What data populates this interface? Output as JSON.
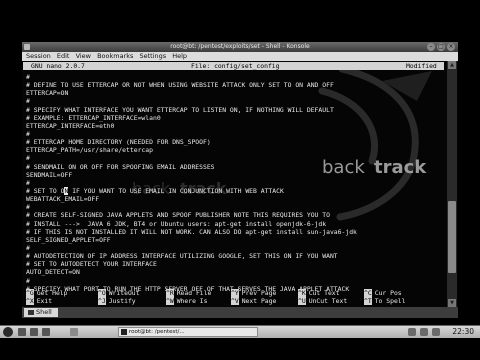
{
  "window": {
    "title": "root@bt: /pentest/exploits/set - Shell - Konsole"
  },
  "menubar": {
    "items": [
      "Session",
      "Edit",
      "View",
      "Bookmarks",
      "Settings",
      "Help"
    ]
  },
  "nano": {
    "version": "GNU nano 2.0.7",
    "file": "File: config/set_config",
    "status": "Modified"
  },
  "editor": {
    "lines": [
      "#",
      "# DEFINE TO USE ETTERCAP OR NOT WHEN USING WEBSITE ATTACK ONLY SET TO ON AND OFF",
      "ETTERCAP=ON",
      "#",
      "# SPECIFY WHAT INTERFACE YOU WANT ETTERCAP TO LISTEN ON, IF NOTHING WILL DEFAULT",
      "# EXAMPLE: ETTERCAP_INTERFACE=wlan0",
      "ETTERCAP_INTERFACE=eth0",
      "#",
      "# ETTERCAP HOME DIRECTORY (NEEDED FOR DNS_SPOOF)",
      "ETTERCAP_PATH=/usr/share/ettercap",
      "#",
      "# SENDMAIL ON OR OFF FOR SPOOFING EMAIL ADDRESSES",
      "SENDMAIL=OFF",
      "#",
      "# SET TO ON IF YOU WANT TO USE EMAIL IN CONJUNCTION WITH WEB ATTACK",
      "WEBATTACK_EMAIL=OFF",
      "#",
      "# CREATE SELF-SIGNED JAVA APPLETS AND SPOOF PUBLISHER NOTE THIS REQUIRES YOU TO",
      "# INSTALL --->  JAVA 6 JDK, BT4 or Ubuntu users: apt-get install openjdk-6-jdk",
      "# IF THIS IS NOT INSTALLED IT WILL NOT WORK. CAN ALSO DO apt-get install sun-java6-jdk",
      "SELF_SIGNED_APPLET=OFF",
      "#",
      "# AUTODETECTION OF IP ADDRESS INTERFACE UTILIZING GOOGLE, SET THIS ON IF YOU WANT",
      "# SET TO AUTODETECT YOUR INTERFACE",
      "AUTO_DETECT=ON",
      "#",
      "# SPECIFY WHAT PORT TO RUN THE HTTP SERVER OFF OF THAT SERVES THE JAVA APPLET ATTACK"
    ],
    "cursor_line": 14,
    "cursor_before": "# SET TO O",
    "cursor_char": "N",
    "cursor_after": " IF YOU WANT TO USE EMAIL IN CONJUNCTION WITH WEB ATTACK"
  },
  "shortcuts": {
    "row1": [
      {
        "key": "^G",
        "label": "Get Help"
      },
      {
        "key": "^O",
        "label": "WriteOut"
      },
      {
        "key": "^R",
        "label": "Read File"
      },
      {
        "key": "^Y",
        "label": "Prev Page"
      },
      {
        "key": "^K",
        "label": "Cut Text"
      },
      {
        "key": "^C",
        "label": "Cur Pos"
      }
    ],
    "row2": [
      {
        "key": "^X",
        "label": "Exit"
      },
      {
        "key": "^J",
        "label": "Justify"
      },
      {
        "key": "^W",
        "label": "Where Is"
      },
      {
        "key": "^V",
        "label": "Next Page"
      },
      {
        "key": "^U",
        "label": "UnCut Text"
      },
      {
        "key": "^T",
        "label": "To Spell"
      }
    ]
  },
  "wallpaper": {
    "brand_left": "back",
    "brand_right": "track"
  },
  "tabs": [
    {
      "label": "Shell"
    }
  ],
  "taskbar": {
    "task_label": "root@bt: /pentest/...",
    "clock": "22:30"
  },
  "colors": {
    "terminal_bg": "#050505",
    "terminal_fg": "#e9e9e9",
    "nano_bar": "#d4d4d4"
  }
}
